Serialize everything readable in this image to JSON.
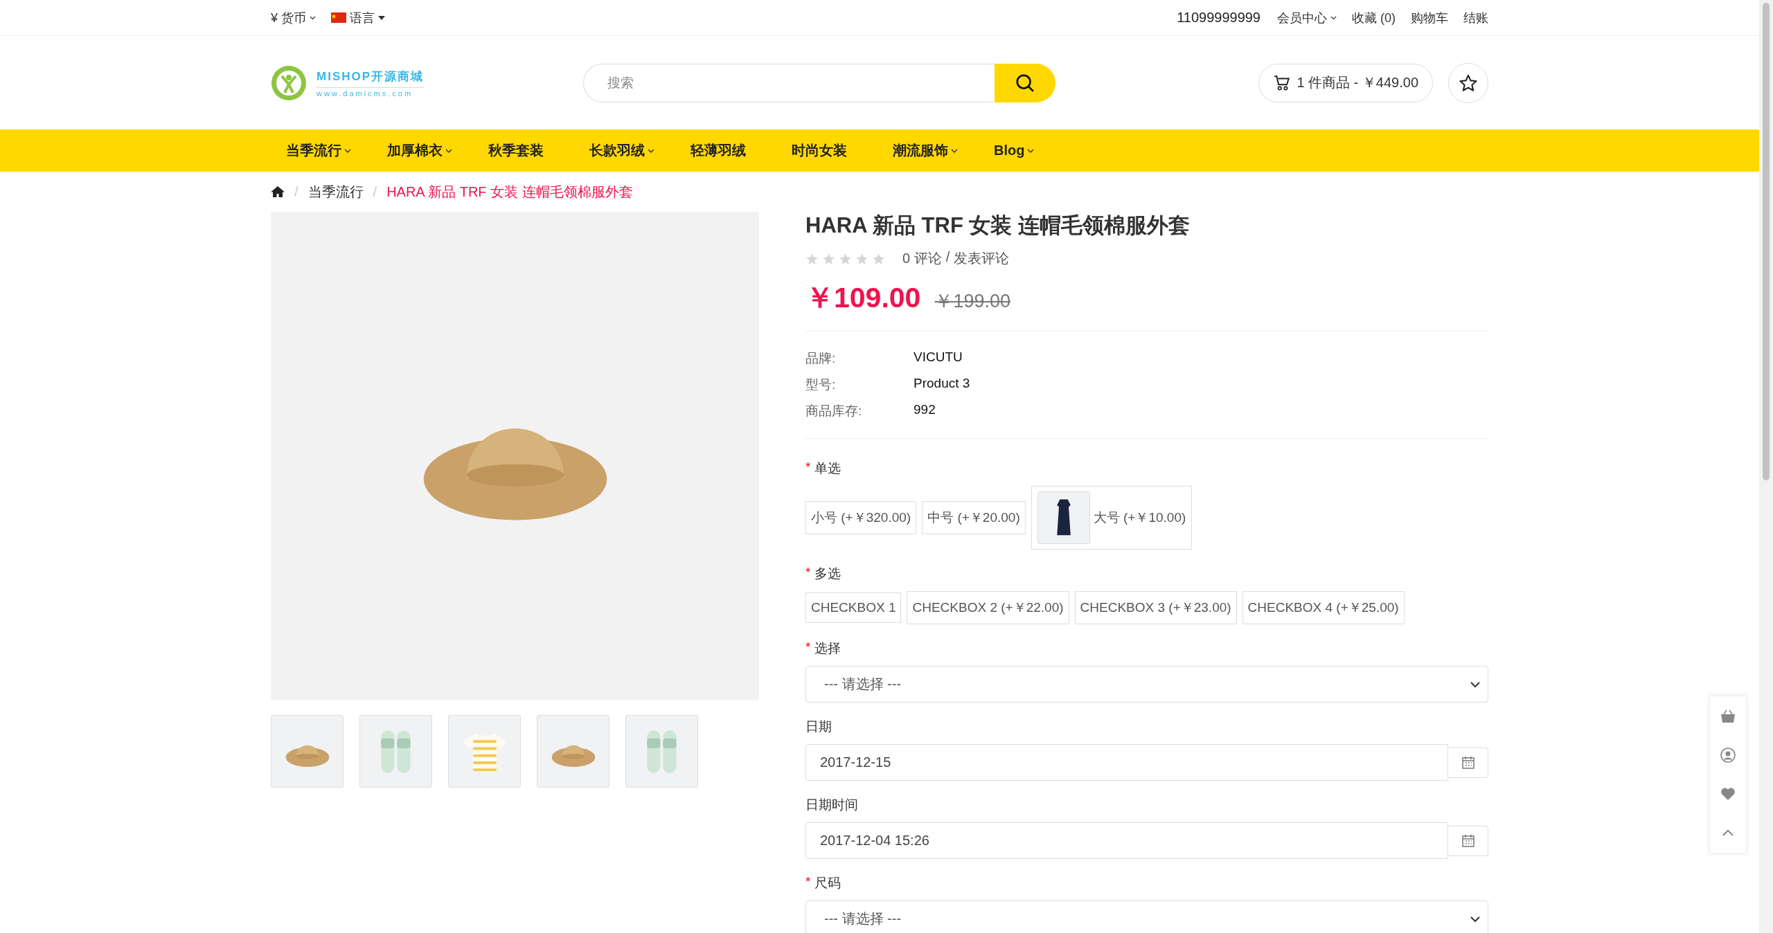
{
  "top_bar": {
    "currency": "¥ 货币",
    "language": "语言",
    "phone": "11099999999",
    "links": [
      {
        "label": "会员中心",
        "dropdown": true
      },
      {
        "label": "收藏 (0)",
        "dropdown": false
      },
      {
        "label": "购物车",
        "dropdown": false
      },
      {
        "label": "结账",
        "dropdown": false
      }
    ]
  },
  "header": {
    "logo": {
      "title": "MISHOP开源商城",
      "subtitle": "www.damicms.com"
    },
    "search": {
      "placeholder": "搜索"
    },
    "cart": "1 件商品 - ￥449.00"
  },
  "nav": [
    {
      "label": "当季流行",
      "dropdown": true
    },
    {
      "label": "加厚棉衣",
      "dropdown": true
    },
    {
      "label": "秋季套装",
      "dropdown": false
    },
    {
      "label": "长款羽绒",
      "dropdown": true
    },
    {
      "label": "轻薄羽绒",
      "dropdown": false
    },
    {
      "label": "时尚女装",
      "dropdown": false
    },
    {
      "label": "潮流服饰",
      "dropdown": true
    },
    {
      "label": "Blog",
      "dropdown": true
    }
  ],
  "breadcrumb": {
    "separator": "/",
    "items": [
      "当季流行",
      "HARA 新品 TRF 女装 连帽毛领棉服外套"
    ]
  },
  "gallery": {
    "main": {
      "kind": "hat"
    },
    "thumbnails": [
      {
        "kind": "hat"
      },
      {
        "kind": "sandals"
      },
      {
        "kind": "shirt"
      },
      {
        "kind": "hat"
      },
      {
        "kind": "sandals"
      }
    ]
  },
  "product": {
    "title": "HARA 新品 TRF 女装 连帽毛领棉服外套",
    "stars": 0,
    "reviews": "0 评论",
    "separator": "/",
    "write_review": "发表评论",
    "price": "￥109.00",
    "old_price": "￥199.00",
    "specs": [
      {
        "label": "品牌:",
        "value": "VICUTU"
      },
      {
        "label": "型号:",
        "value": "Product 3"
      },
      {
        "label": "商品库存:",
        "value": "992"
      }
    ]
  },
  "options": [
    {
      "kind": "radio",
      "mark": "*",
      "label": "单选",
      "choices": [
        {
          "label": "小号 (+￥320.00)",
          "image": false
        },
        {
          "label": "中号 (+￥20.00)",
          "image": false
        },
        {
          "label": "大号 (+￥10.00)",
          "image": true
        }
      ]
    },
    {
      "kind": "checkbox",
      "mark": "*",
      "label": "多选",
      "choices": [
        {
          "label": "CHECKBOX 1",
          "image": false
        },
        {
          "label": "CHECKBOX 2 (+￥22.00)",
          "image": false
        },
        {
          "label": "CHECKBOX 3 (+￥23.00)",
          "image": false
        },
        {
          "label": "CHECKBOX 4 (+￥25.00)",
          "image": false
        }
      ]
    },
    {
      "kind": "select",
      "mark": "*",
      "label": "选择",
      "placeholder": "--- 请选择 ---"
    },
    {
      "kind": "date",
      "label": "日期",
      "value": "2017-12-15"
    },
    {
      "kind": "date",
      "label": "日期时间",
      "value": "2017-12-04 15:26"
    },
    {
      "kind": "select",
      "mark": "*",
      "label": "尺码",
      "placeholder": "--- 请选择 ---"
    }
  ]
}
